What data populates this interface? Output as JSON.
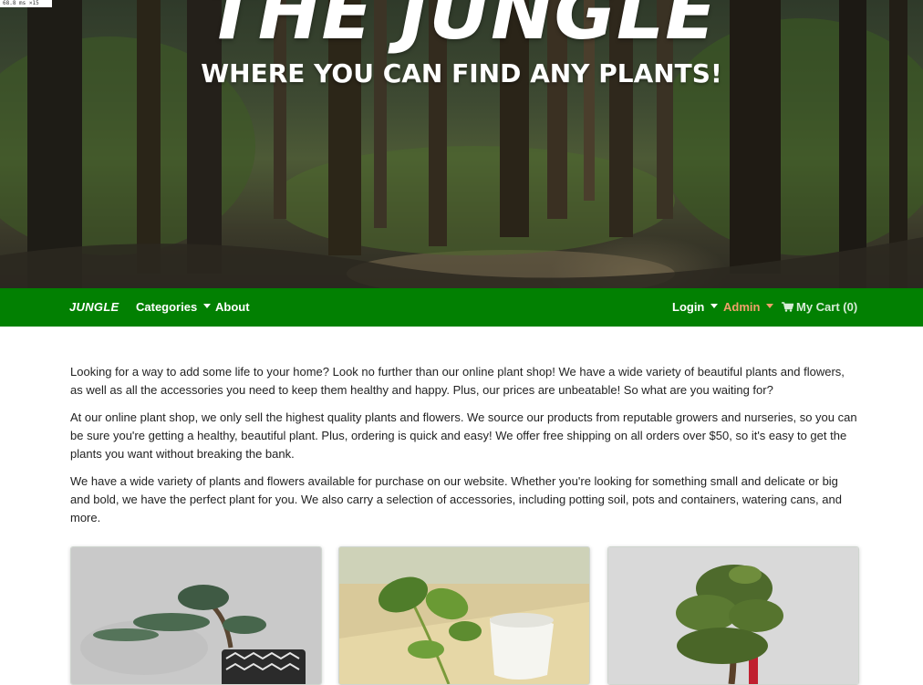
{
  "hero": {
    "perf_badge": "68.8 ms ×15",
    "title": "THE JUNGLE",
    "subtitle": "WHERE YOU CAN FIND ANY PLANTS!"
  },
  "nav": {
    "brand": "JUNGLE",
    "categories": "Categories",
    "about": "About",
    "login": "Login",
    "admin": "Admin",
    "cart": "My Cart (0)",
    "colors": {
      "bar": "#028002",
      "admin": "#f0a06a"
    }
  },
  "content": {
    "paragraphs": [
      "Looking for a way to add some life to your home? Look no further than our online plant shop! We have a wide variety of beautiful plants and flowers, as well as all the accessories you need to keep them healthy and happy. Plus, our prices are unbeatable! So what are you waiting for?",
      "At our online plant shop, we only sell the highest quality plants and flowers. We source our products from reputable growers and nurseries, so you can be sure you're getting a healthy, beautiful plant. Plus, ordering is quick and easy! We offer free shipping on all orders over $50, so it's easy to get the plants you want without breaking the bank.",
      "We have a wide variety of plants and flowers available for purchase on our website. Whether you're looking for something small and delicate or big and bold, we have the perfect plant for you. We also carry a selection of accessories, including potting soil, pots and containers, watering cans, and more."
    ]
  },
  "products": [
    {
      "icon": "juniper-bonsai-image"
    },
    {
      "icon": "pothos-plant-image"
    },
    {
      "icon": "bonsai-tree-image"
    }
  ]
}
